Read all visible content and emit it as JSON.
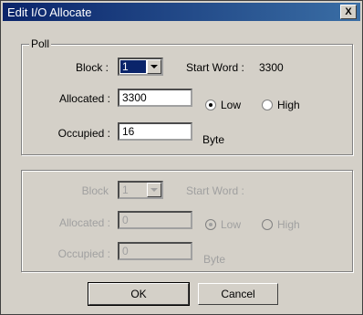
{
  "window": {
    "title": "Edit I/O Allocate",
    "close_label": "X"
  },
  "poll": {
    "group_label": "Poll",
    "block_label": "Block :",
    "block_value": "1",
    "start_word_label": "Start Word :",
    "start_word_value": "3300",
    "allocated_label": "Allocated :",
    "allocated_value": "3300",
    "radio_low": "Low",
    "radio_high": "High",
    "occupied_label": "Occupied :",
    "occupied_value": "16",
    "occupied_unit": "Byte"
  },
  "second": {
    "block_label": "Block",
    "block_value": "1",
    "start_word_label": "Start Word :",
    "allocated_label": "Allocated :",
    "allocated_value": "0",
    "radio_low": "Low",
    "radio_high": "High",
    "occupied_label": "Occupied :",
    "occupied_value": "0",
    "occupied_unit": "Byte"
  },
  "buttons": {
    "ok": "OK",
    "cancel": "Cancel"
  }
}
